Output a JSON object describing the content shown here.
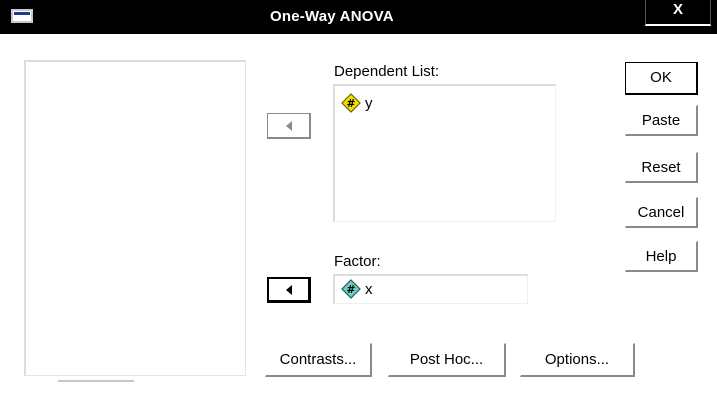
{
  "window": {
    "title": "One-Way ANOVA",
    "close_label": "X"
  },
  "dependent": {
    "label": "Dependent List:",
    "items": [
      {
        "name": "y",
        "icon": "scale-variable-icon"
      }
    ]
  },
  "factor": {
    "label": "Factor:",
    "item": {
      "name": "x",
      "icon": "scale-variable-icon"
    }
  },
  "buttons": {
    "ok": "OK",
    "paste": "Paste",
    "reset": "Reset",
    "cancel": "Cancel",
    "help": "Help"
  },
  "bottom_buttons": {
    "contrasts": "Contrasts...",
    "post_hoc": "Post Hoc...",
    "options": "Options..."
  },
  "colors": {
    "icon_yellow": "#f2e200",
    "icon_teal": "#6ecfc1",
    "title_bg": "#000000"
  }
}
